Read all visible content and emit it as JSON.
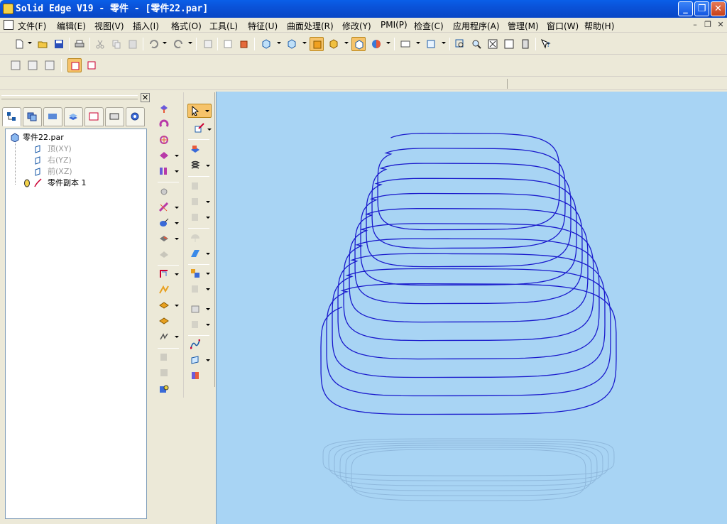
{
  "window": {
    "title": "Solid Edge V19 - 零件 - [零件22.par]",
    "controls": [
      "_",
      "❐",
      "✕"
    ]
  },
  "menu": [
    "文件(F)",
    "编辑(E)",
    "视图(V)",
    "插入(I)",
    "格式(O)",
    "工具(L)",
    "特征(U)",
    "曲面处理(R)",
    "修改(Y)",
    "PMI(P)",
    "检查(C)",
    "应用程序(A)",
    "管理(M)",
    "窗口(W)",
    "帮助(H)"
  ],
  "mdi_controls": [
    "–",
    "❐",
    "✕"
  ],
  "panel": {
    "close_glyph": "✕"
  },
  "tree": {
    "root": "零件22.par",
    "items": [
      "顶(XY)",
      "右(YZ)",
      "前(XZ)",
      "零件副本 1"
    ]
  },
  "colors": {
    "viewport_bg": "#a8d4f4",
    "curve": "#1a1acc",
    "titlebar": "#0a52d8",
    "active_button": "#f6c36a"
  },
  "icons": {
    "toolbar1": [
      "new-icon",
      "open-icon",
      "save-icon",
      "print-icon",
      "cut-icon",
      "copy-icon",
      "paste-icon",
      "undo-icon",
      "redo-icon",
      "insert-object-icon",
      "properties-icon",
      "component-icon",
      "view-orient-icon",
      "view-iso-icon",
      "shaded-icon",
      "shaded-edges-icon",
      "visible-edges-icon",
      "render-icon",
      "layers-icon",
      "named-views-icon",
      "zoom-area-icon",
      "zoom-icon",
      "fit-icon",
      "pan-icon",
      "rotate-icon",
      "help-icon"
    ],
    "toolbar2": [
      "sketch-icon",
      "feature-icon",
      "library-icon",
      "select-filter-icon",
      "quick-pick-icon"
    ]
  }
}
